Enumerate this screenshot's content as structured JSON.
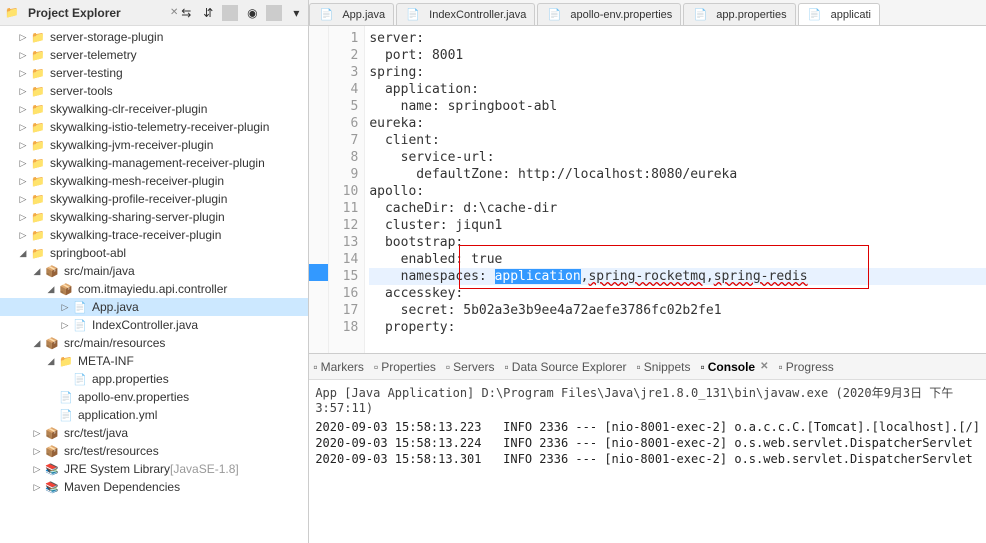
{
  "project_explorer": {
    "title": "Project Explorer",
    "tree": [
      {
        "level": 1,
        "twisty": "closed",
        "icon": "folder",
        "label": "server-storage-plugin"
      },
      {
        "level": 1,
        "twisty": "closed",
        "icon": "folder",
        "label": "server-telemetry"
      },
      {
        "level": 1,
        "twisty": "closed",
        "icon": "folder",
        "label": "server-testing"
      },
      {
        "level": 1,
        "twisty": "closed",
        "icon": "folder",
        "label": "server-tools"
      },
      {
        "level": 1,
        "twisty": "closed",
        "icon": "folder",
        "label": "skywalking-clr-receiver-plugin"
      },
      {
        "level": 1,
        "twisty": "closed",
        "icon": "folder",
        "label": "skywalking-istio-telemetry-receiver-plugin"
      },
      {
        "level": 1,
        "twisty": "closed",
        "icon": "folder",
        "label": "skywalking-jvm-receiver-plugin"
      },
      {
        "level": 1,
        "twisty": "closed",
        "icon": "folder",
        "label": "skywalking-management-receiver-plugin"
      },
      {
        "level": 1,
        "twisty": "closed",
        "icon": "folder",
        "label": "skywalking-mesh-receiver-plugin"
      },
      {
        "level": 1,
        "twisty": "closed",
        "icon": "folder",
        "label": "skywalking-profile-receiver-plugin"
      },
      {
        "level": 1,
        "twisty": "closed",
        "icon": "folder",
        "label": "skywalking-sharing-server-plugin"
      },
      {
        "level": 1,
        "twisty": "closed",
        "icon": "folder",
        "label": "skywalking-trace-receiver-plugin"
      },
      {
        "level": 1,
        "twisty": "open",
        "icon": "folder",
        "label": "springboot-abl"
      },
      {
        "level": 2,
        "twisty": "open",
        "icon": "package",
        "label": "src/main/java"
      },
      {
        "level": 3,
        "twisty": "open",
        "icon": "package",
        "label": "com.itmayiedu.api.controller"
      },
      {
        "level": 4,
        "twisty": "closed",
        "icon": "java",
        "label": "App.java",
        "selected": true
      },
      {
        "level": 4,
        "twisty": "closed",
        "icon": "java",
        "label": "IndexController.java"
      },
      {
        "level": 2,
        "twisty": "open",
        "icon": "package",
        "label": "src/main/resources"
      },
      {
        "level": 3,
        "twisty": "open",
        "icon": "folder",
        "label": "META-INF"
      },
      {
        "level": 4,
        "twisty": "none",
        "icon": "file",
        "label": "app.properties"
      },
      {
        "level": 3,
        "twisty": "none",
        "icon": "file",
        "label": "apollo-env.properties"
      },
      {
        "level": 3,
        "twisty": "none",
        "icon": "file",
        "label": "application.yml"
      },
      {
        "level": 2,
        "twisty": "closed",
        "icon": "package",
        "label": "src/test/java"
      },
      {
        "level": 2,
        "twisty": "closed",
        "icon": "package",
        "label": "src/test/resources"
      },
      {
        "level": 2,
        "twisty": "closed",
        "icon": "lib",
        "label": "JRE System Library",
        "decor": " [JavaSE-1.8]"
      },
      {
        "level": 2,
        "twisty": "closed",
        "icon": "lib",
        "label": "Maven Dependencies"
      }
    ]
  },
  "editor_tabs": [
    {
      "icon": "java",
      "label": "App.java"
    },
    {
      "icon": "java",
      "label": "IndexController.java"
    },
    {
      "icon": "file",
      "label": "apollo-env.properties"
    },
    {
      "icon": "file",
      "label": "app.properties"
    },
    {
      "icon": "file",
      "label": "applicati",
      "active": true
    }
  ],
  "code": {
    "lines": [
      "server:",
      "  port: 8001",
      "spring:",
      "  application:",
      "    name: springboot-abl",
      "eureka:",
      "  client:",
      "    service-url:",
      "      defaultZone: http://localhost:8080/eureka",
      "apollo:",
      "  cacheDir: d:\\cache-dir",
      "  cluster: jiqun1",
      "  bootstrap: ",
      "    enabled: true",
      "    namespaces: application,spring-rocketmq,spring-redis",
      "  accesskey:",
      "    secret: 5b02a3e3b9ee4a72aefe3786fc02b2fe1",
      "  property:"
    ],
    "highlight_line": 15,
    "selection": "application",
    "error_words": [
      "spring-rocketmq",
      "spring-redis"
    ]
  },
  "bottom_tabs": [
    {
      "label": "Markers"
    },
    {
      "label": "Properties"
    },
    {
      "label": "Servers"
    },
    {
      "label": "Data Source Explorer"
    },
    {
      "label": "Snippets"
    },
    {
      "label": "Console",
      "active": true
    },
    {
      "label": "Progress"
    }
  ],
  "console": {
    "title": "App [Java Application] D:\\Program Files\\Java\\jre1.8.0_131\\bin\\javaw.exe (2020年9月3日 下午3:57:11)",
    "lines": [
      "2020-09-03 15:58:13.223   INFO 2336 --- [nio-8001-exec-2] o.a.c.c.C.[Tomcat].[localhost].[/]",
      "2020-09-03 15:58:13.224   INFO 2336 --- [nio-8001-exec-2] o.s.web.servlet.DispatcherServlet",
      "2020-09-03 15:58:13.301   INFO 2336 --- [nio-8001-exec-2] o.s.web.servlet.DispatcherServlet"
    ]
  }
}
